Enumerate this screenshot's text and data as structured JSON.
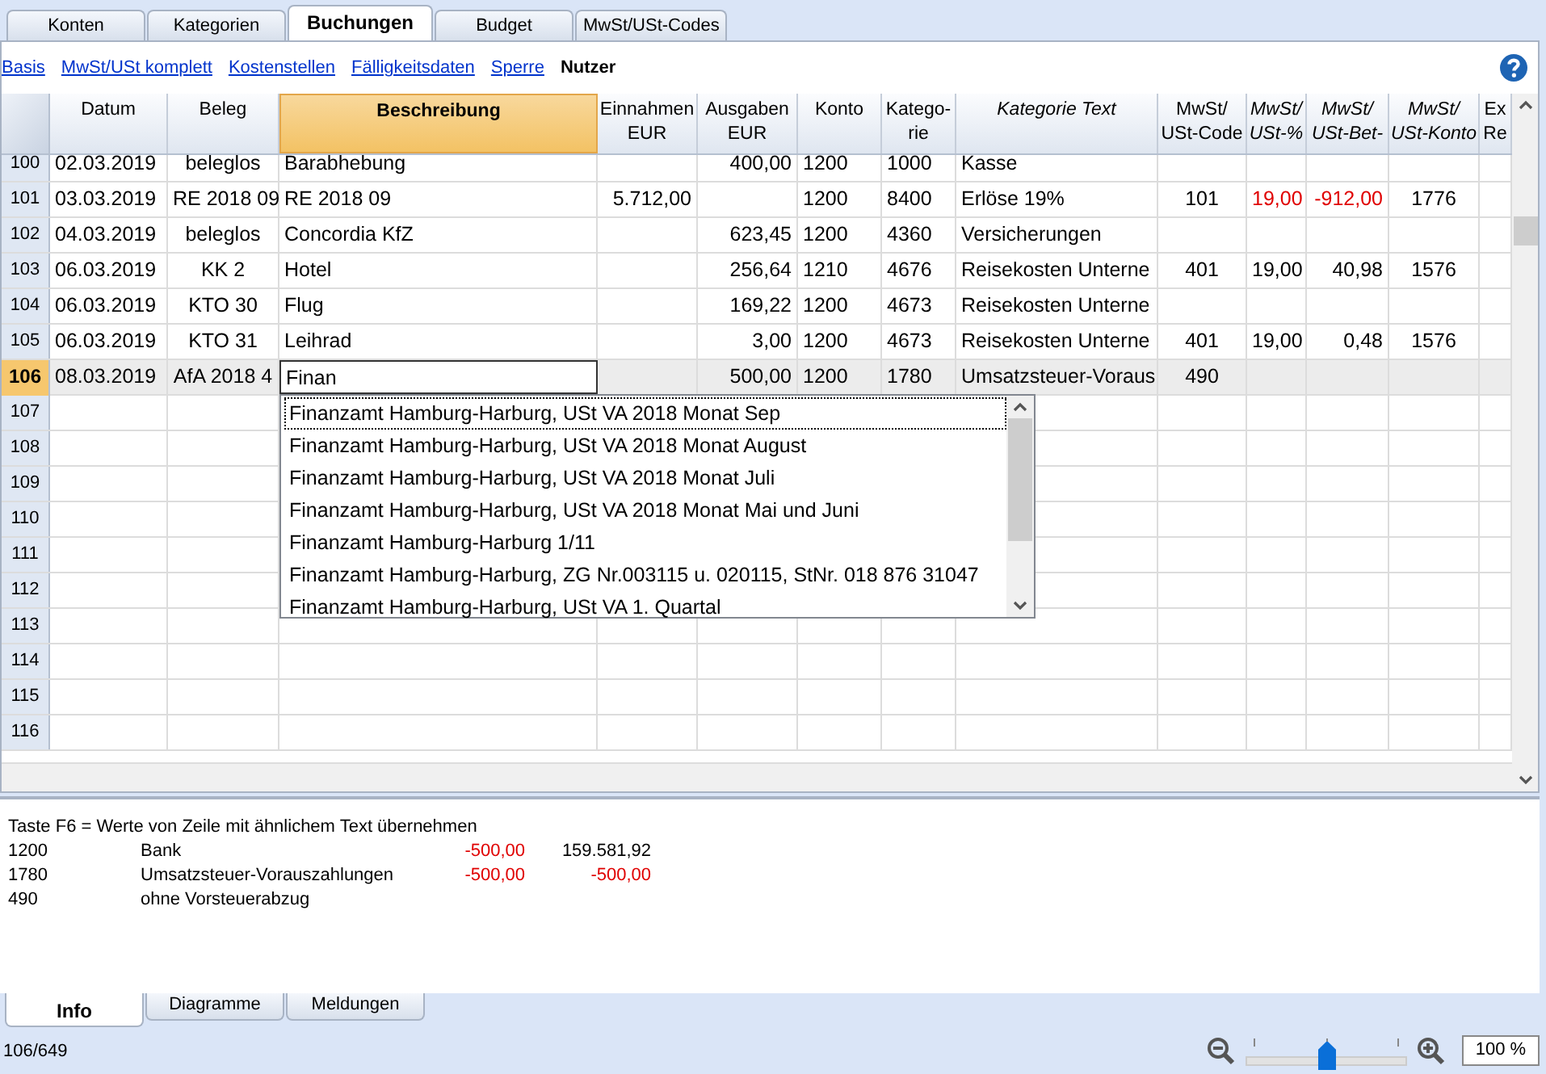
{
  "tabs": [
    {
      "label": "Konten",
      "selected": false
    },
    {
      "label": "Kategorien",
      "selected": false
    },
    {
      "label": "Buchungen",
      "selected": true
    },
    {
      "label": "Budget",
      "selected": false
    },
    {
      "label": "MwSt/USt-Codes",
      "selected": false
    }
  ],
  "views": [
    {
      "label": "Basis",
      "selected": false
    },
    {
      "label": "MwSt/USt komplett",
      "selected": false
    },
    {
      "label": "Kostenstellen",
      "selected": false
    },
    {
      "label": "Fälligkeitsdaten",
      "selected": false
    },
    {
      "label": "Sperre",
      "selected": false
    },
    {
      "label": "Nutzer",
      "selected": true
    }
  ],
  "table": {
    "columns": [
      {
        "label": "Datum",
        "selected": false
      },
      {
        "label": "Beleg",
        "selected": false
      },
      {
        "label": "Beschreibung",
        "selected": true
      },
      {
        "label": "Einnahmen\nEUR",
        "selected": false
      },
      {
        "label": "Ausgaben\nEUR",
        "selected": false
      },
      {
        "label": "Konto",
        "selected": false
      },
      {
        "label": "Katego-\nrie",
        "selected": false
      },
      {
        "label": "Kategorie Text",
        "selected": false
      },
      {
        "label": "MwSt/\nUSt-Code",
        "selected": false
      },
      {
        "label": "MwSt/\nUSt-%",
        "selected": false
      },
      {
        "label": "MwSt/\nUSt-Bet-",
        "selected": false
      },
      {
        "label": "MwSt/\nUSt-Konto",
        "selected": false
      },
      {
        "label": "Ex\nRe",
        "selected": false
      }
    ],
    "rows": [
      {
        "number": "100",
        "selected": false,
        "cells": [
          "02.03.2019",
          "beleglos",
          "Barabhebung",
          null,
          "400,00",
          "1200",
          "1000",
          "Kasse"
        ]
      },
      {
        "number": "101",
        "selected": false,
        "vat_alert": true,
        "cells": [
          "03.03.2019",
          "RE 2018 09",
          "RE 2018 09",
          "5.712,00",
          null,
          "1200",
          "8400",
          "Erlöse 19%",
          "101",
          "19,00",
          "-912,00",
          "1776"
        ]
      },
      {
        "number": "102",
        "selected": false,
        "cells": [
          "04.03.2019",
          "beleglos",
          "Concordia KfZ",
          null,
          "623,45",
          "1200",
          "4360",
          "Versicherungen"
        ]
      },
      {
        "number": "103",
        "selected": false,
        "vat_alert": false,
        "cells": [
          "06.03.2019",
          "KK 2",
          "Hotel",
          null,
          "256,64",
          "1210",
          "4676",
          "Reisekosten Unterne",
          "401",
          "19,00",
          "40,98",
          "1576"
        ]
      },
      {
        "number": "104",
        "selected": false,
        "cells": [
          "06.03.2019",
          "KTO 30",
          "Flug",
          null,
          "169,22",
          "1200",
          "4673",
          "Reisekosten Unterne"
        ]
      },
      {
        "number": "105",
        "selected": false,
        "vat_alert": false,
        "cells": [
          "06.03.2019",
          "KTO 31",
          "Leihrad",
          null,
          "3,00",
          "1200",
          "4673",
          "Reisekosten Unterne",
          "401",
          "19,00",
          "0,48",
          "1576"
        ]
      },
      {
        "number": "106",
        "selected": true,
        "editing": true,
        "cells": [
          "08.03.2019",
          "AfA 2018 4",
          "Finan",
          null,
          "500,00",
          "1200",
          "1780",
          "Umsatzsteuer-Voraus",
          "490"
        ]
      },
      {
        "number": "107",
        "selected": false
      },
      {
        "number": "108",
        "selected": false
      },
      {
        "number": "109",
        "selected": false
      },
      {
        "number": "110",
        "selected": false
      },
      {
        "number": "111",
        "selected": false
      },
      {
        "number": "112",
        "selected": false
      },
      {
        "number": "113",
        "selected": false
      },
      {
        "number": "114",
        "selected": false
      },
      {
        "number": "115",
        "selected": false
      },
      {
        "number": "116",
        "selected": false
      }
    ]
  },
  "autocomplete": [
    {
      "label": "Finanzamt Hamburg-Harburg, USt VA 2018 Monat Sep",
      "selected": true
    },
    {
      "label": "Finanzamt Hamburg-Harburg, USt VA 2018 Monat August",
      "selected": false
    },
    {
      "label": "Finanzamt Hamburg-Harburg, USt VA 2018 Monat Juli",
      "selected": false
    },
    {
      "label": "Finanzamt Hamburg-Harburg, USt VA 2018 Monat Mai und Juni",
      "selected": false
    },
    {
      "label": "Finanzamt Hamburg-Harburg 1/11",
      "selected": false
    },
    {
      "label": "Finanzamt Hamburg-Harburg, ZG Nr.003115 u. 020115, StNr. 018 876 31047",
      "selected": false
    },
    {
      "label": "Finanzamt Hamburg-Harburg, USt VA 1. Quartal",
      "selected": false
    }
  ],
  "info": {
    "hint": "Taste F6 = Werte von Zeile mit ähnlichem Text übernehmen",
    "lines": [
      {
        "code": "1200",
        "name": "Bank",
        "amount": "-500,00",
        "amount_negative": true,
        "balance": "159.581,92",
        "balance_negative": false
      },
      {
        "code": "1780",
        "name": "Umsatzsteuer-Vorauszahlungen",
        "amount": "-500,00",
        "amount_negative": true,
        "balance": "-500,00",
        "balance_negative": true
      },
      {
        "code": "490",
        "name": "ohne Vorsteuerabzug"
      }
    ]
  },
  "bottom_tabs": [
    {
      "label": "Info",
      "selected": true
    },
    {
      "label": "Diagramme",
      "selected": false
    },
    {
      "label": "Meldungen",
      "selected": false
    }
  ],
  "status_bar": {
    "position": "106/649",
    "zoom": {
      "level": 0.5,
      "value": "100 %"
    }
  }
}
